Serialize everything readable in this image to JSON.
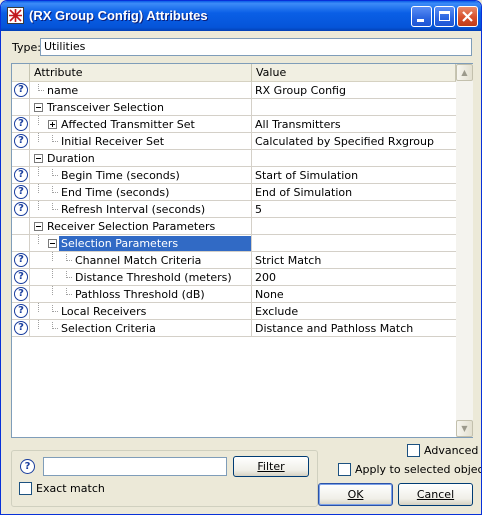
{
  "window": {
    "title": "(RX Group Config) Attributes",
    "controls": {
      "minimize": "minimize",
      "maximize": "maximize",
      "close": "close"
    }
  },
  "type_row": {
    "label": "Type:",
    "value": "Utilities"
  },
  "grid": {
    "columns": {
      "attribute": "Attribute",
      "value": "Value"
    },
    "rows": [
      {
        "attribute": "name",
        "value": "RX Group Config",
        "help": true,
        "depth": 0,
        "expander": "",
        "selected": false
      },
      {
        "attribute": "Transceiver Selection",
        "value": "",
        "help": false,
        "depth": 0,
        "expander": "minus",
        "selected": false
      },
      {
        "attribute": "Affected Transmitter Set",
        "value": "All Transmitters",
        "help": true,
        "depth": 1,
        "expander": "plus",
        "selected": false
      },
      {
        "attribute": "Initial Receiver Set",
        "value": "Calculated by Specified Rxgroup",
        "help": true,
        "depth": 1,
        "expander": "",
        "selected": false
      },
      {
        "attribute": "Duration",
        "value": "",
        "help": false,
        "depth": 0,
        "expander": "minus",
        "selected": false
      },
      {
        "attribute": "Begin Time (seconds)",
        "value": "Start of Simulation",
        "help": true,
        "depth": 1,
        "expander": "",
        "selected": false
      },
      {
        "attribute": "End Time (seconds)",
        "value": "End of Simulation",
        "help": true,
        "depth": 1,
        "expander": "",
        "selected": false
      },
      {
        "attribute": "Refresh Interval (seconds)",
        "value": "5",
        "help": true,
        "depth": 1,
        "expander": "",
        "selected": false
      },
      {
        "attribute": "Receiver Selection Parameters",
        "value": "",
        "help": false,
        "depth": 0,
        "expander": "minus",
        "selected": false
      },
      {
        "attribute": "Selection Parameters",
        "value": "",
        "help": false,
        "depth": 1,
        "expander": "minus",
        "selected": true
      },
      {
        "attribute": "Channel Match Criteria",
        "value": "Strict Match",
        "help": true,
        "depth": 2,
        "expander": "",
        "selected": false
      },
      {
        "attribute": "Distance Threshold (meters)",
        "value": "200",
        "help": true,
        "depth": 2,
        "expander": "",
        "selected": false
      },
      {
        "attribute": "Pathloss Threshold (dB)",
        "value": "None",
        "help": true,
        "depth": 2,
        "expander": "",
        "selected": false
      },
      {
        "attribute": "Local Receivers",
        "value": "Exclude",
        "help": true,
        "depth": 1,
        "expander": "",
        "selected": false
      },
      {
        "attribute": "Selection Criteria",
        "value": "Distance and Pathloss Match",
        "help": true,
        "depth": 1,
        "expander": "",
        "selected": false
      }
    ]
  },
  "filter": {
    "input_value": "",
    "button_label": "Filter",
    "exact_match_label": "Exact match",
    "exact_match_checked": false
  },
  "options": {
    "advanced_label": "Advanced",
    "advanced_checked": false,
    "apply_selected_label": "Apply to selected objects",
    "apply_selected_checked": false
  },
  "buttons": {
    "ok": "OK",
    "cancel": "Cancel"
  },
  "icons": {
    "help": "?",
    "app": "app-icon",
    "scroll_up": "▲",
    "scroll_down": "▼"
  },
  "colors": {
    "selection": "#316ac5",
    "title_bar": "#0554d8",
    "close_button": "#d8502c"
  }
}
